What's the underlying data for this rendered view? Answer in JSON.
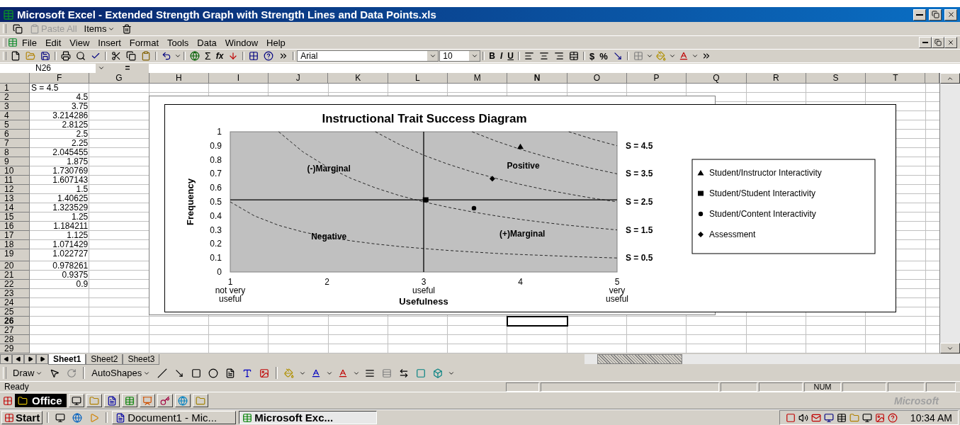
{
  "window": {
    "title": "Microsoft Excel - Extended Strength Graph with Strength Lines and Data Points.xls"
  },
  "clipboard_toolbar": {
    "paste_all": {
      "label": "Paste All",
      "disabled": true
    },
    "items": {
      "label": "Items"
    }
  },
  "menu": [
    "File",
    "Edit",
    "View",
    "Insert",
    "Format",
    "Tools",
    "Data",
    "Window",
    "Help"
  ],
  "standard_toolbar": {
    "autosum": "Σ",
    "function": "fx"
  },
  "formatting_toolbar": {
    "font": "Arial",
    "size": "10",
    "bold": "B",
    "italic": "I",
    "underline": "U",
    "currency": "$",
    "percent": "%"
  },
  "formula_bar": {
    "name_box": "N26",
    "equals": "="
  },
  "columns": [
    {
      "label": "F",
      "selected": false
    },
    {
      "label": "G",
      "selected": false
    },
    {
      "label": "H",
      "selected": false
    },
    {
      "label": "I",
      "selected": false
    },
    {
      "label": "J",
      "selected": false
    },
    {
      "label": "K",
      "selected": false
    },
    {
      "label": "L",
      "selected": false
    },
    {
      "label": "M",
      "selected": false
    },
    {
      "label": "N",
      "selected": true
    },
    {
      "label": "O",
      "selected": false
    },
    {
      "label": "P",
      "selected": false
    },
    {
      "label": "Q",
      "selected": false
    },
    {
      "label": "R",
      "selected": false
    },
    {
      "label": "S",
      "selected": false
    },
    {
      "label": "T",
      "selected": false
    }
  ],
  "rows": [
    {
      "label": "1",
      "selected": false,
      "kind": "text",
      "value": "S = 4.5"
    },
    {
      "label": "2",
      "selected": false,
      "kind": "number",
      "value": "4.5"
    },
    {
      "label": "3",
      "selected": false,
      "kind": "number",
      "value": "3.75"
    },
    {
      "label": "4",
      "selected": false,
      "kind": "number",
      "value": "3.214286"
    },
    {
      "label": "5",
      "selected": false,
      "kind": "number",
      "value": "2.8125"
    },
    {
      "label": "6",
      "selected": false,
      "kind": "number",
      "value": "2.5"
    },
    {
      "label": "7",
      "selected": false,
      "kind": "number",
      "value": "2.25"
    },
    {
      "label": "8",
      "selected": false,
      "kind": "number",
      "value": "2.045455"
    },
    {
      "label": "9",
      "selected": false,
      "kind": "number",
      "value": "1.875"
    },
    {
      "label": "10",
      "selected": false,
      "kind": "number",
      "value": "1.730769"
    },
    {
      "label": "11",
      "selected": false,
      "kind": "number",
      "value": "1.607143"
    },
    {
      "label": "12",
      "selected": false,
      "kind": "number",
      "value": "1.5"
    },
    {
      "label": "13",
      "selected": false,
      "kind": "number",
      "value": "1.40625"
    },
    {
      "label": "14",
      "selected": false,
      "kind": "number",
      "value": "1.323529"
    },
    {
      "label": "15",
      "selected": false,
      "kind": "number",
      "value": "1.25"
    },
    {
      "label": "16",
      "selected": false,
      "kind": "number",
      "value": "1.184211"
    },
    {
      "label": "17",
      "selected": false,
      "kind": "number",
      "value": "1.125"
    },
    {
      "label": "18",
      "selected": false,
      "kind": "number",
      "value": "1.071429"
    },
    {
      "label": "19",
      "selected": false,
      "kind": "number",
      "value": "1.022727"
    },
    {
      "label": "20",
      "selected": false,
      "kind": "number",
      "value": "0.978261"
    },
    {
      "label": "21",
      "selected": false,
      "kind": "number",
      "value": "0.9375"
    },
    {
      "label": "22",
      "selected": false,
      "kind": "number",
      "value": "0.9"
    },
    {
      "label": "23",
      "selected": false
    },
    {
      "label": "24",
      "selected": false
    },
    {
      "label": "25",
      "selected": false
    },
    {
      "label": "26",
      "selected": true
    },
    {
      "label": "27",
      "selected": false
    },
    {
      "label": "28",
      "selected": false
    },
    {
      "label": "29",
      "selected": false
    }
  ],
  "chart": {
    "chart_data": {
      "type": "scatter",
      "title": "Instructional Trait Success Diagram",
      "xlabel": "Usefulness",
      "ylabel": "Frequency",
      "xlim": [
        1,
        5
      ],
      "ylim": [
        0,
        1
      ],
      "xticks": [
        {
          "value": 1,
          "label": "1\nnot very\nuseful"
        },
        {
          "value": 2,
          "label": "2"
        },
        {
          "value": 3,
          "label": "3\nuseful"
        },
        {
          "value": 4,
          "label": "4"
        },
        {
          "value": 5,
          "label": "5\nvery\nuseful"
        }
      ],
      "yticks": [
        {
          "value": 0,
          "label": "0"
        },
        {
          "value": 0.1,
          "label": "0.1"
        },
        {
          "value": 0.2,
          "label": "0.2"
        },
        {
          "value": 0.3,
          "label": "0.3"
        },
        {
          "value": 0.4,
          "label": "0.4"
        },
        {
          "value": 0.5,
          "label": "0.5"
        },
        {
          "value": 0.6,
          "label": "0.6"
        },
        {
          "value": 0.7,
          "label": "0.7"
        },
        {
          "value": 0.8,
          "label": "0.8"
        },
        {
          "value": 0.9,
          "label": "0.9"
        },
        {
          "value": 1,
          "label": "1"
        }
      ],
      "series": [
        {
          "name": "Student/Instructor Interactivity",
          "x": [
            4
          ],
          "values": [
            0.895
          ]
        },
        {
          "name": "Student/Student Interactivity",
          "x": [
            3.02
          ],
          "values": [
            0.515
          ]
        },
        {
          "name": "Student/Content Interactivity",
          "x": [
            3.52
          ],
          "values": [
            0.455
          ]
        },
        {
          "name": "Assessment",
          "x": [
            3.71
          ],
          "values": [
            0.665
          ]
        },
        {
          "name": "S = 4.5",
          "type": "line",
          "line_style": "dashed",
          "x": [
            4.5,
            4.75,
            5
          ],
          "values": [
            1,
            0.947,
            0.9
          ]
        },
        {
          "name": "S = 3.5",
          "type": "line",
          "line_style": "dashed",
          "x": [
            3.5,
            3.75,
            4,
            4.25,
            4.5,
            4.75,
            5
          ],
          "values": [
            1,
            0.933,
            0.875,
            0.824,
            0.778,
            0.737,
            0.7
          ]
        },
        {
          "name": "S = 2.5",
          "type": "line",
          "line_style": "dashed",
          "x": [
            2.5,
            2.75,
            3,
            3.25,
            3.5,
            3.75,
            4,
            4.25,
            4.5,
            4.75,
            5
          ],
          "values": [
            1,
            0.909,
            0.833,
            0.769,
            0.714,
            0.667,
            0.625,
            0.588,
            0.556,
            0.526,
            0.5
          ]
        },
        {
          "name": "S = 1.5",
          "type": "line",
          "line_style": "dashed",
          "x": [
            1.5,
            1.75,
            2,
            2.25,
            2.5,
            2.75,
            3,
            3.25,
            3.5,
            3.75,
            4,
            4.25,
            4.5,
            4.75,
            5
          ],
          "values": [
            1,
            0.857,
            0.75,
            0.667,
            0.6,
            0.545,
            0.5,
            0.462,
            0.429,
            0.4,
            0.375,
            0.353,
            0.333,
            0.316,
            0.3
          ]
        },
        {
          "name": "S = 0.5",
          "type": "line",
          "line_style": "dashed",
          "x": [
            1,
            1.25,
            1.5,
            1.75,
            2,
            2.25,
            2.5,
            2.75,
            3,
            3.25,
            3.5,
            3.75,
            4,
            4.25,
            4.5,
            4.75,
            5
          ],
          "values": [
            0.5,
            0.4,
            0.333,
            0.286,
            0.25,
            0.222,
            0.2,
            0.182,
            0.167,
            0.154,
            0.143,
            0.133,
            0.125,
            0.118,
            0.111,
            0.105,
            0.1
          ]
        }
      ],
      "ref_lines": [
        {
          "axis": "x",
          "value": 3
        },
        {
          "axis": "y",
          "value": 0.515
        }
      ],
      "legend": "right",
      "annotations": [
        "(-)Marginal",
        "Positive",
        "Negative",
        "(+)Marginal"
      ]
    }
  },
  "sheet_tabs": [
    {
      "label": "Sheet1",
      "selected": true
    },
    {
      "label": "Sheet2",
      "selected": false
    },
    {
      "label": "Sheet3",
      "selected": false
    }
  ],
  "drawing_toolbar": {
    "draw": "Draw",
    "autoshapes": "AutoShapes"
  },
  "status_bar": {
    "text": "Ready",
    "num": "NUM"
  },
  "office_bar": {
    "label": "Office",
    "brand": "Microsoft"
  },
  "taskbar": {
    "start": "Start",
    "tasks": [
      {
        "label": "Document1 - Mic...",
        "kind": "word",
        "selected": false
      },
      {
        "label": "Microsoft Exc...",
        "kind": "excel",
        "selected": true
      }
    ],
    "clock": "10:34 AM"
  }
}
